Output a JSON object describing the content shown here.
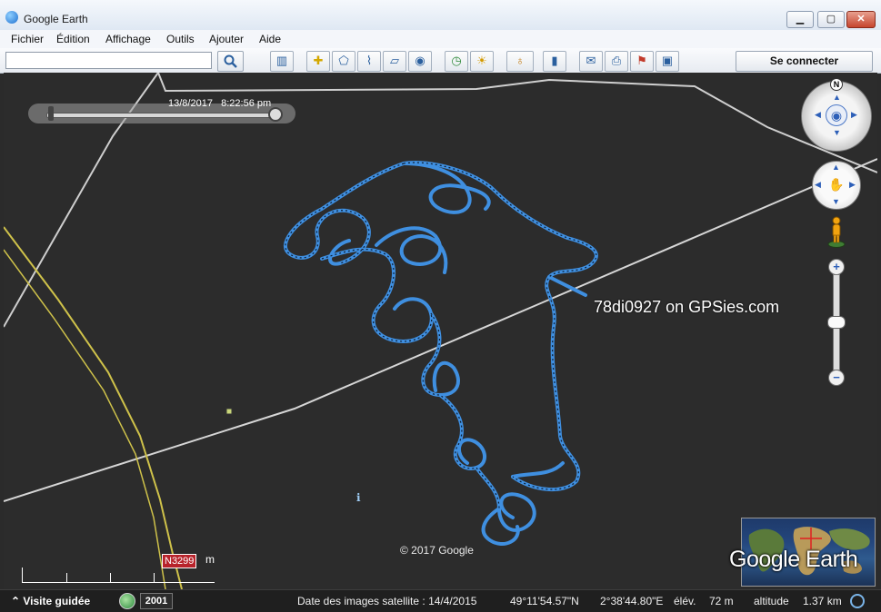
{
  "window": {
    "title": "Google Earth",
    "minimize": "▁",
    "maximize": "▢",
    "close": "✕"
  },
  "menu": [
    "Fichier",
    "Édition",
    "Affichage",
    "Outils",
    "Ajouter",
    "Aide"
  ],
  "search": {
    "value": "",
    "placeholder": ""
  },
  "toolbar": {
    "icons": [
      "sidebar-toggle-icon",
      "placemark-icon",
      "polygon-icon",
      "path-icon",
      "image-overlay-icon",
      "record-tour-icon",
      "historical-imagery-icon",
      "sunlight-icon",
      "planets-icon",
      "ruler-icon",
      "email-icon",
      "print-icon",
      "view-in-maps-icon",
      "save-image-icon"
    ],
    "signin_label": "Se connecter"
  },
  "map": {
    "time_label": "13/8/2017   8:22:56 pm",
    "track_label": "78di0927 on GPSies.com",
    "copyright": "© 2017 Google",
    "road_tag": "N3299",
    "scale_unit": "m",
    "compass_label": "N",
    "zoom_in": "+",
    "zoom_out": "−",
    "logo": "Google Earth",
    "track_color": "#3f8fe0"
  },
  "status": {
    "tour_label": "Visite guidée",
    "year": "2001",
    "imagery_date": "Date des images satellite : 14/4/2015",
    "latitude": "49°11'54.57\"N",
    "longitude": "2°38'44.80\"E",
    "elevation_label": "élév.",
    "elevation_value": "72 m",
    "altitude_label": "altitude",
    "altitude_value": "1.37 km"
  }
}
